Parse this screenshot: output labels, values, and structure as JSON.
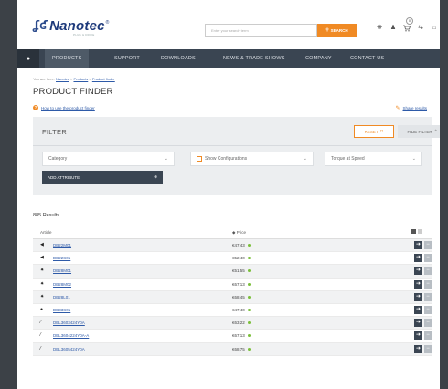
{
  "header": {
    "logo_mark": "ʆʛ",
    "logo_text": "Nanotec",
    "logo_reg": "®",
    "logo_tagline": "PLUG & DRIVE",
    "search_placeholder": "Enter your search term",
    "search_button": "SEARCH",
    "cart_count": "0",
    "icons": [
      "grid-icon",
      "user-icon",
      "cart-icon",
      "compare-icon",
      "home-icon"
    ]
  },
  "nav": {
    "items": [
      "PRODUCTS",
      "SUPPORT",
      "DOWNLOADS",
      "NEWS & TRADE SHOWS",
      "COMPANY",
      "CONTACT US"
    ],
    "active": "PRODUCTS"
  },
  "breadcrumb": [
    "You are here:",
    "Nanotec",
    "Products",
    "Product finder"
  ],
  "page_title": "PRODUCT FINDER",
  "help_link": "How to use the product finder",
  "share_link": "Share results",
  "filter": {
    "title": "FILTER",
    "reset_label": "RESET",
    "hide_label": "HIDE FILTER",
    "category_placeholder": "Category",
    "show_configurations": "Show Configurations",
    "torque_placeholder": "Torque at Speed",
    "add_attribute": "ADD ATTRIBUTE"
  },
  "results": {
    "count_label": "885 Results",
    "columns": {
      "article": "Article",
      "price": "Price"
    },
    "rows": [
      {
        "article": "DB22M01",
        "price": "€47,43",
        "icon": "motor-icon"
      },
      {
        "article": "DB22S01",
        "price": "€52,40",
        "icon": "motor-icon"
      },
      {
        "article": "DB28M01",
        "price": "€51,55",
        "icon": "motor-icon"
      },
      {
        "article": "DB28M02",
        "price": "€67,13",
        "icon": "motor-icon"
      },
      {
        "article": "DB28L01",
        "price": "€68,45",
        "icon": "motor-icon"
      },
      {
        "article": "DB33S01",
        "price": "€47,40",
        "icon": "motor-icon"
      },
      {
        "article": "DBL3603424Y0A",
        "price": "€63,22",
        "icon": "motor-icon"
      },
      {
        "article": "DBL3604224Y0A-A",
        "price": "€67,13",
        "icon": "motor-icon"
      },
      {
        "article": "DBL3605424Y0A",
        "price": "€68,75",
        "icon": "motor-icon"
      }
    ]
  },
  "colors": {
    "accent": "#f08a24",
    "nav_bg": "#3a4552",
    "link": "#2e5aa8",
    "stock_dot": "#7bbf3a"
  }
}
